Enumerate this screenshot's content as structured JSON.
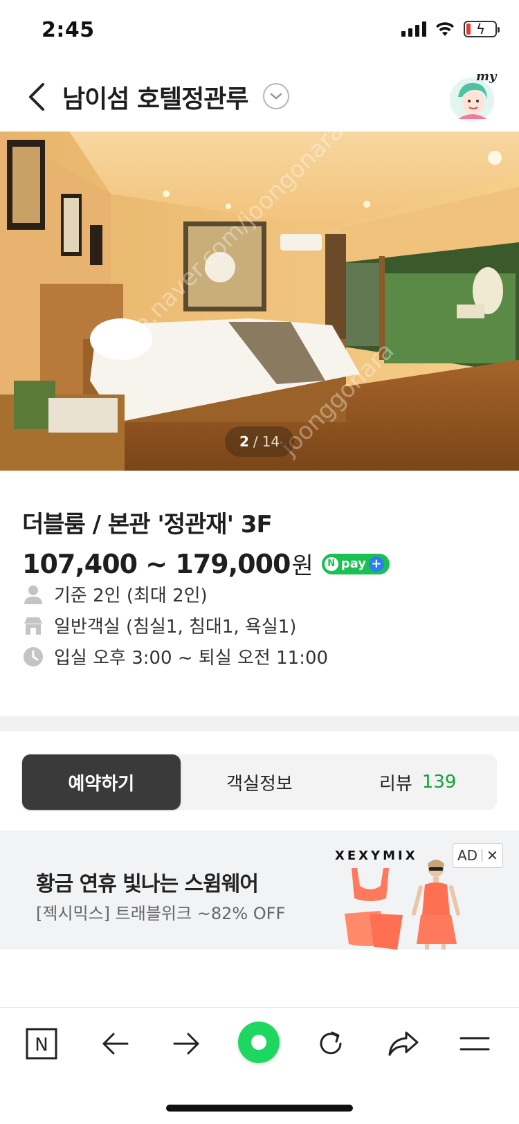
{
  "status_bar": {
    "time": "2:45",
    "battery_level": 0.15
  },
  "header": {
    "title": "남이섬 호텔정관루",
    "avatar_text": "my"
  },
  "hero": {
    "current": "2",
    "separator": "/",
    "total": "14",
    "watermark_lines": [
      "cafe.naver.com/joongonara",
      "joonggonara"
    ]
  },
  "room": {
    "name": "더블룸 / 본관 '정관재' 3F",
    "price": "107,400 ~ 179,000",
    "price_unit": "원",
    "npay_label": "pay",
    "npay_n": "N",
    "npay_plus": "+",
    "details": [
      {
        "icon": "person-icon",
        "text": "기준 2인 (최대 2인)"
      },
      {
        "icon": "building-icon",
        "text": "일반객실 (침실1, 침대1, 욕실1)"
      },
      {
        "icon": "clock-icon",
        "text": "입실 오후 3:00 ~ 퇴실 오전 11:00"
      }
    ]
  },
  "tabs": {
    "reserve": "예약하기",
    "room_info": "객실정보",
    "review": "리뷰",
    "review_count": "139"
  },
  "ad": {
    "headline": "황금 연휴 빛나는 스윔웨어",
    "sub": "[젝시믹스] 트래블위크 ~82% OFF",
    "brand": "XEXYMIX",
    "tag": "AD",
    "close": "✕",
    "colors": {
      "product": "#ff7a5c"
    }
  },
  "toolbar": {
    "icons": [
      "naver-n-icon",
      "back-arrow-icon",
      "forward-arrow-icon",
      "green-home-button",
      "refresh-icon",
      "share-icon",
      "menu-icon"
    ],
    "n_label": "N"
  }
}
